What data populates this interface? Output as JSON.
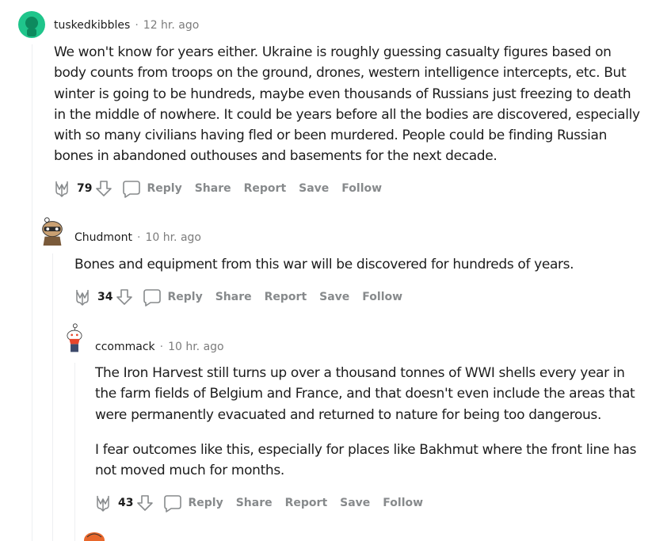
{
  "comments": [
    {
      "username": "tuskedkibbles",
      "time": "12 hr. ago",
      "paragraphs": [
        "We won't know for years either. Ukraine is roughly guessing casualty figures based on",
        "body counts from troops on the ground, drones, western intelligence intercepts, etc. But",
        "winter is going to be hundreds, maybe even thousands of Russians just freezing to death",
        "in the middle of nowhere. It could be years before all the bodies are discovered, especially",
        "with so many civilians having fled or been murdered. People could be finding Russian",
        "bones in abandoned outhouses and basements for the next decade."
      ],
      "score": "79",
      "actions": {
        "reply": "Reply",
        "share": "Share",
        "report": "Report",
        "save": "Save",
        "follow": "Follow"
      }
    },
    {
      "username": "Chudmont",
      "time": "10 hr. ago",
      "paragraphs": [
        "Bones and equipment from this war will be discovered for hundreds of years."
      ],
      "score": "34",
      "actions": {
        "reply": "Reply",
        "share": "Share",
        "report": "Report",
        "save": "Save",
        "follow": "Follow"
      }
    },
    {
      "username": "ccommack",
      "time": "10 hr. ago",
      "paragraphs": [
        "The Iron Harvest still turns up over a thousand tonnes of WWI shells every year in",
        "the farm fields of Belgium and France, and that doesn't even include the areas that",
        "were permanently evacuated and returned to nature for being too dangerous.",
        "I fear outcomes like this, especially for places like Bakhmut where the front line has",
        "not moved much for months."
      ],
      "score": "43",
      "actions": {
        "reply": "Reply",
        "share": "Share",
        "report": "Report",
        "save": "Save",
        "follow": "Follow"
      }
    }
  ],
  "header_separator": "·",
  "colors": {
    "meta": "#878a8c",
    "text": "#1c1c1c",
    "thread_line": "#edeff1",
    "avatar_green": "#1fc58b"
  }
}
